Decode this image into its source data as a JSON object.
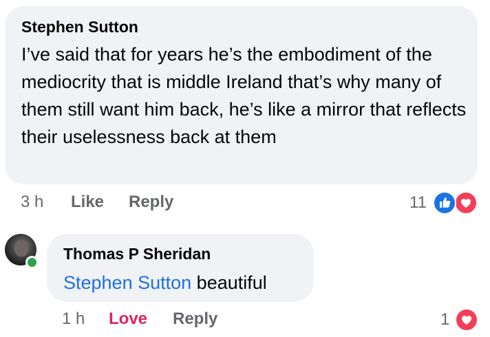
{
  "comment": {
    "author": "Stephen Sutton",
    "text": "I’ve said that for years he’s the embodiment of the mediocrity that is middle Ireland that’s why many of them still want him back, he’s like a mirror that reflects their uselessness back at them",
    "time": "3 h",
    "like_label": "Like",
    "reply_label": "Reply",
    "reaction_count": "11",
    "reactions": [
      "like-icon",
      "love-icon"
    ]
  },
  "reply": {
    "author": "Thomas P Sheridan",
    "mention": "Stephen Sutton",
    "text": "beautiful",
    "time": "1 h",
    "like_label": "Love",
    "reply_label": "Reply",
    "reaction_count": "1",
    "reactions": [
      "love-icon"
    ],
    "online": true
  },
  "colors": {
    "bubble": "#f0f2f5",
    "mention": "#216fdb",
    "love": "#e0245e",
    "like_reaction": "#1b74e4",
    "love_reaction": "#f33e58",
    "online": "#31a24c",
    "meta": "#65676b"
  }
}
